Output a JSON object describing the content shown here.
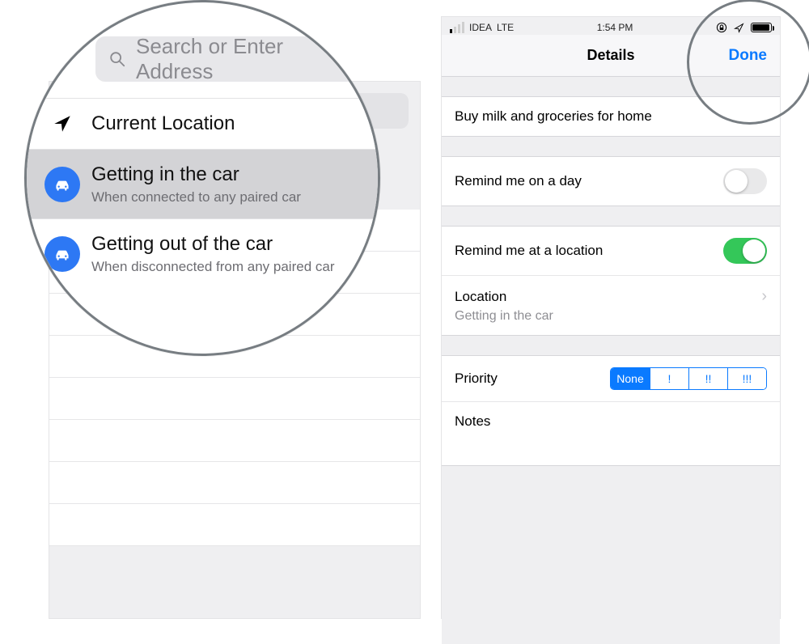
{
  "left": {
    "search_placeholder": "Search or Enter Address",
    "items": [
      {
        "title": "Current Location",
        "sub": ""
      },
      {
        "title": "Getting in the car",
        "sub": "When connected to any paired car"
      },
      {
        "title": "Getting out of the car",
        "sub": "When disconnected from any paired car"
      }
    ]
  },
  "right": {
    "status": {
      "carrier": "IDEA",
      "network": "LTE",
      "time": "1:54 PM"
    },
    "navbar": {
      "title": "Details",
      "done": "Done"
    },
    "reminder_text": "Buy milk and groceries for home",
    "remind_day": {
      "label": "Remind me on a day",
      "on": false
    },
    "remind_loc": {
      "label": "Remind me at a location",
      "on": true
    },
    "location": {
      "label": "Location",
      "value": "Getting in the car"
    },
    "priority": {
      "label": "Priority",
      "options": [
        "None",
        "!",
        "!!",
        "!!!"
      ],
      "selected": 0
    },
    "notes_label": "Notes"
  }
}
